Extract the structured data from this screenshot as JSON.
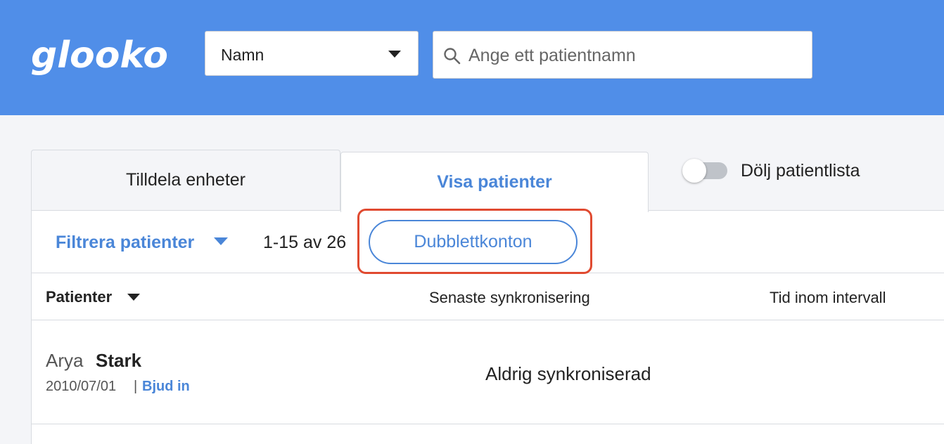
{
  "header": {
    "logo_text": "glooko",
    "search_type": {
      "selected": "Namn"
    },
    "search": {
      "placeholder": "Ange ett patientnamn",
      "value": ""
    }
  },
  "tabs": [
    {
      "label": "Tilldela enheter",
      "active": false
    },
    {
      "label": "Visa patienter",
      "active": true
    }
  ],
  "toggle": {
    "label": "Dölj patientlista",
    "on": false
  },
  "toolbar": {
    "filter_label": "Filtrera patienter",
    "range_text": "1-15 av 26",
    "duplicates_button": "Dubblettkonton"
  },
  "table": {
    "columns": [
      "Patienter",
      "Senaste synkronisering",
      "Tid inom intervall"
    ],
    "rows": [
      {
        "first_name": "Arya",
        "last_name": "Stark",
        "dob": "2010/07/01",
        "separator": "|",
        "action": "Bjud in",
        "last_sync": "Aldrig synkroniserad",
        "time_in_range": ""
      }
    ]
  },
  "colors": {
    "header_bg": "#508ee8",
    "accent": "#4a86d8",
    "highlight": "#e04a30"
  }
}
